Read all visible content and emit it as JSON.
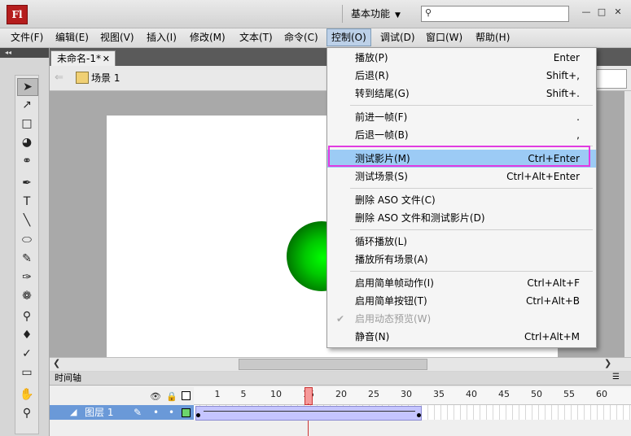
{
  "app": {
    "logo_text": "Fl",
    "workspace": "基本功能"
  },
  "menubar": [
    "文件(F)",
    "编辑(E)",
    "视图(V)",
    "插入(I)",
    "修改(M)",
    "文本(T)",
    "命令(C)",
    "控制(O)",
    "调试(D)",
    "窗口(W)",
    "帮助(H)"
  ],
  "document": {
    "tab": "未命名-1*",
    "scene": "场景 1"
  },
  "control_menu": {
    "items": [
      {
        "label": "播放(P)",
        "shortcut": "Enter"
      },
      {
        "label": "后退(R)",
        "shortcut": "Shift+,"
      },
      {
        "label": "转到结尾(G)",
        "shortcut": "Shift+."
      },
      {
        "label": "前进一帧(F)",
        "shortcut": "."
      },
      {
        "label": "后退一帧(B)",
        "shortcut": ","
      },
      {
        "label": "测试影片(M)",
        "shortcut": "Ctrl+Enter"
      },
      {
        "label": "测试场景(S)",
        "shortcut": "Ctrl+Alt+Enter"
      },
      {
        "label": "删除 ASO 文件(C)",
        "shortcut": ""
      },
      {
        "label": "删除 ASO 文件和测试影片(D)",
        "shortcut": ""
      },
      {
        "label": "循环播放(L)",
        "shortcut": ""
      },
      {
        "label": "播放所有场景(A)",
        "shortcut": ""
      },
      {
        "label": "启用简单帧动作(I)",
        "shortcut": "Ctrl+Alt+F"
      },
      {
        "label": "启用简单按钮(T)",
        "shortcut": "Ctrl+Alt+B"
      },
      {
        "label": "启用动态预览(W)",
        "shortcut": ""
      },
      {
        "label": "静音(N)",
        "shortcut": "Ctrl+Alt+M"
      }
    ]
  },
  "timeline": {
    "title": "时间轴",
    "layer": "图层 1",
    "ruler": [
      "1",
      "5",
      "10",
      "15",
      "20",
      "25",
      "30",
      "35",
      "40",
      "45",
      "50",
      "55",
      "60"
    ],
    "current_frame": 18,
    "tween_end_frame": 35
  },
  "colors": {
    "highlight": "#9ccbf5",
    "annotation_box": "#e13be1",
    "ball": "#00c800"
  }
}
